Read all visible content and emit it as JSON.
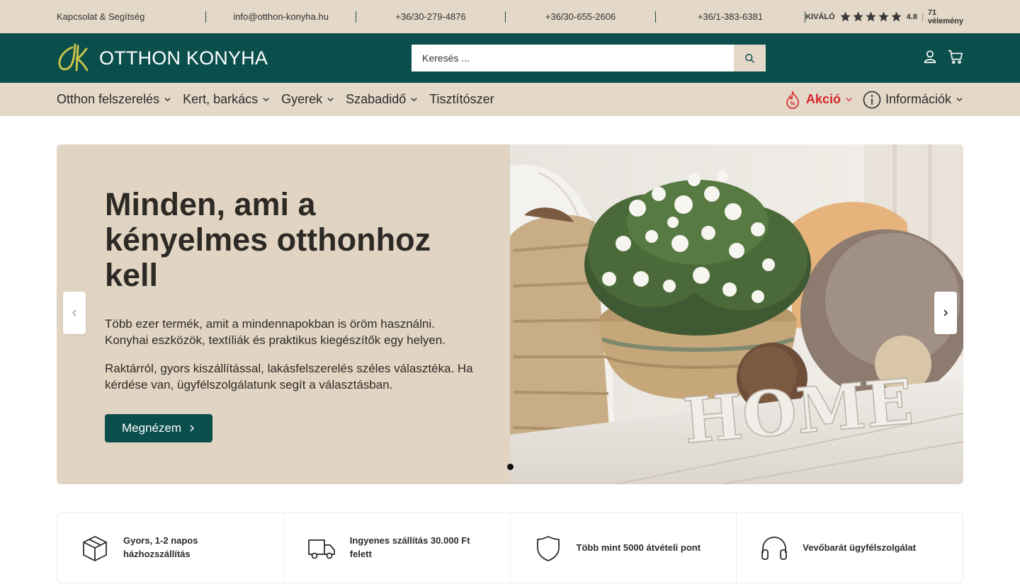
{
  "topbar": {
    "help_link": "Kapcsolat & Segítség",
    "email": "info@otthon-konyha.hu",
    "phones": [
      "+36/30-279-4876",
      "+36/30-655-2606",
      "+36/1-383-6381"
    ],
    "rating": {
      "label": "KIVÁLÓ",
      "stars": 5,
      "score": "4.8",
      "separator": "|",
      "reviews": "71 vélemény"
    }
  },
  "header": {
    "brand": "OTTHON KONYHA",
    "search_placeholder": "Keresés ...",
    "icons": [
      "account-icon",
      "cart-icon"
    ]
  },
  "nav": {
    "items": [
      {
        "label": "Otthon felszerelés",
        "has_dropdown": true
      },
      {
        "label": "Kert, barkács",
        "has_dropdown": true
      },
      {
        "label": "Gyerek",
        "has_dropdown": true
      },
      {
        "label": "Szabadidő",
        "has_dropdown": true
      },
      {
        "label": "Tisztítószer",
        "has_dropdown": false
      }
    ],
    "sale": {
      "label": "Akció",
      "icon": "sale-flame-icon",
      "color": "#d6262b"
    },
    "info": {
      "label": "Információk",
      "icon": "info-icon"
    }
  },
  "hero": {
    "title": "Minden, ami a kényelmes otthonhoz kell",
    "paragraph1": "Több ezer termék, amit a mindennapokban is öröm használni. Konyhai eszközök, textíliák és praktikus kiegészítők egy helyen.",
    "paragraph2": "Raktárról, gyors kiszállítással, lakásfelszerelés széles választéka. Ha kérdése van, ügyfélszolgálatunk segít a választásban.",
    "cta": "Megnézem",
    "image_text": "HOME"
  },
  "features": [
    {
      "icon": "box-icon",
      "text": "Gyors, 1-2 napos házhozszállítás"
    },
    {
      "icon": "truck-icon",
      "text": "Ingyenes szállítás 30.000 Ft felett"
    },
    {
      "icon": "shield-icon",
      "text": "Több mint 5000 átvételi pont"
    },
    {
      "icon": "headphones-icon",
      "text": "Vevőbarát ügyfélszolgálat"
    }
  ],
  "colors": {
    "brand_dark": "#0a4f4c",
    "beige": "#e4d8c8",
    "hero_beige": "#e2d4c2",
    "sale_red": "#d6262b",
    "logo_gold": "#c9c24a"
  }
}
